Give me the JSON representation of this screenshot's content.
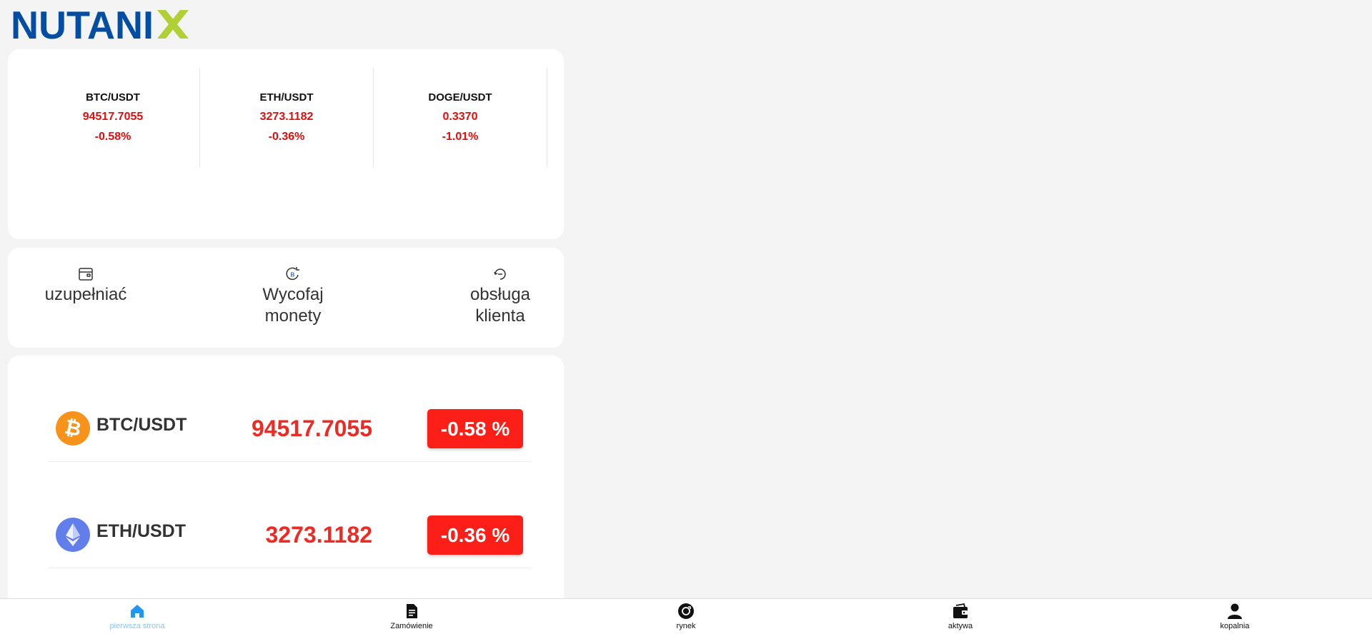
{
  "brand": {
    "name": "NUTANIX",
    "colors": {
      "blue": "#034ea2",
      "green": "#afd136"
    }
  },
  "tickers": [
    {
      "pair": "BTC/USDT",
      "price": "94517.7055",
      "change": "-0.58%"
    },
    {
      "pair": "ETH/USDT",
      "price": "3273.1182",
      "change": "-0.36%"
    },
    {
      "pair": "DOGE/USDT",
      "price": "0.3370",
      "change": "-1.01%"
    }
  ],
  "actions": [
    {
      "label": "uzupełniać",
      "icon": "wallet-icon"
    },
    {
      "label": "Wycofaj monety",
      "icon": "bitcoin-withdraw-icon"
    },
    {
      "label": "obsługa klienta",
      "icon": "support-icon"
    }
  ],
  "markets": [
    {
      "pair": "BTC/USDT",
      "price": "94517.7055",
      "change": "-0.58 %",
      "icon": "bitcoin-icon"
    },
    {
      "pair": "ETH/USDT",
      "price": "3273.1182",
      "change": "-0.36 %",
      "icon": "ethereum-icon"
    }
  ],
  "nav": [
    {
      "label": "pierwsza strona",
      "icon": "home-icon",
      "active": true
    },
    {
      "label": "Zamówienie",
      "icon": "document-icon",
      "active": false
    },
    {
      "label": "rynek",
      "icon": "market-icon",
      "active": false
    },
    {
      "label": "aktywa",
      "icon": "wallet-icon",
      "active": false
    },
    {
      "label": "kopalnia",
      "icon": "user-icon",
      "active": false
    }
  ],
  "colors": {
    "negative": "#e30d0d",
    "badge": "#fc1f18",
    "active_nav": "#8ec5ef",
    "bitcoin": "#f7931a",
    "ethereum": "#627eea"
  }
}
